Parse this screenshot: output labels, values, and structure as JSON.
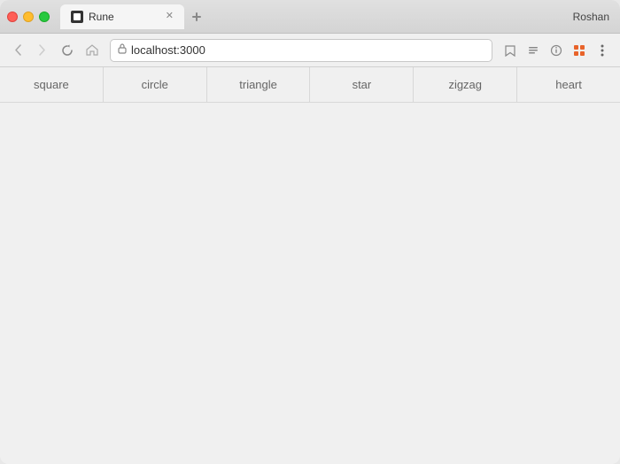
{
  "window": {
    "title": "Rune",
    "user": "Roshan"
  },
  "browser": {
    "url": "localhost:3000",
    "back_label": "‹",
    "forward_label": "›",
    "reload_label": "↻",
    "home_label": "⌂"
  },
  "tabs": [
    {
      "label": "Rune",
      "active": true
    }
  ],
  "shapes": [
    {
      "id": "square",
      "label": "square"
    },
    {
      "id": "circle",
      "label": "circle"
    },
    {
      "id": "triangle",
      "label": "triangle"
    },
    {
      "id": "star",
      "label": "star"
    },
    {
      "id": "zigzag",
      "label": "zigzag"
    },
    {
      "id": "heart",
      "label": "heart"
    }
  ],
  "toolbar": {
    "bookmark_icon": "☆",
    "reader_icon": "≡",
    "info_icon": "ⓘ",
    "extensions_icon": "🧩",
    "menu_icon": "⋮"
  }
}
